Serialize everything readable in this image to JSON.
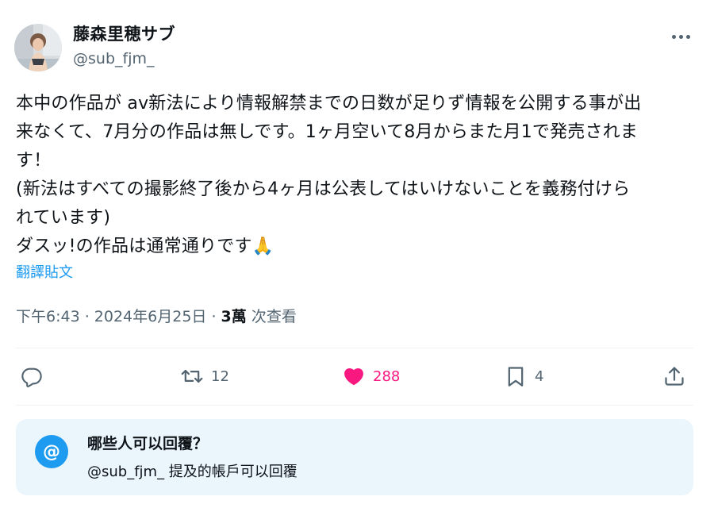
{
  "author": {
    "display_name": "藤森里穂サブ",
    "handle": "@sub_fjm_"
  },
  "tweet": {
    "text": "本中の作品が av新法により情報解禁までの日数が足りず情報を公開する事が出\n来なくて、7月分の作品は無しです。1ヶ月空いて8月からまた月1で発売されま\nす！\n(新法はすべての撮影終了後から4ヶ月は公表してはいけないことを義務付けら\nれています)\nダスッ!の作品は通常通りです🙏",
    "translate_label": "翻譯貼文"
  },
  "meta": {
    "time": "下午6:43",
    "sep1": " · ",
    "date": "2024年6月25日",
    "sep2": " · ",
    "views_count": "3萬",
    "views_label": " 次查看"
  },
  "actions": {
    "reply_count": "",
    "retweet_count": "12",
    "like_count": "288",
    "bookmark_count": "4",
    "like_color": "#f91880"
  },
  "reply_restriction": {
    "badge": "@",
    "title": "哪些人可以回覆？",
    "subtitle": "@sub_fjm_ 提及的帳戶可以回覆"
  },
  "icons": [
    "more-icon",
    "reply-icon",
    "retweet-icon",
    "like-icon",
    "bookmark-icon",
    "share-icon",
    "mention-icon"
  ]
}
